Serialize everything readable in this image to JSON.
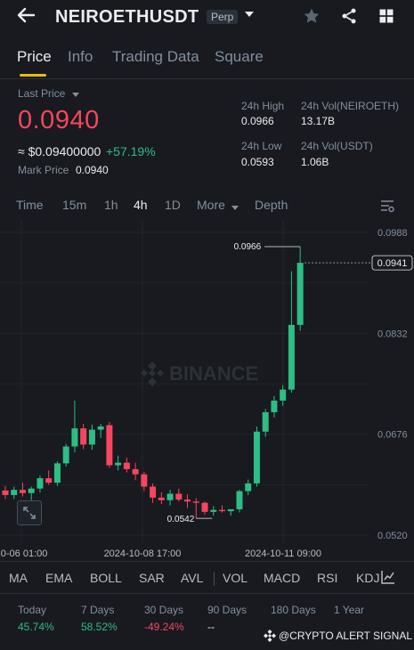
{
  "header": {
    "symbol": "NEIROETHUSDT",
    "contract_type": "Perp",
    "icons": [
      "back-arrow-icon",
      "chevron-down-icon",
      "star-icon",
      "share-icon",
      "grid-icon"
    ]
  },
  "tabs": [
    {
      "label": "Price",
      "active": true
    },
    {
      "label": "Info",
      "active": false
    },
    {
      "label": "Trading Data",
      "active": false
    },
    {
      "label": "Square",
      "active": false
    }
  ],
  "ticker": {
    "last_price_label": "Last Price",
    "last_price": "0.0940",
    "fiat_value": "≈ $0.09400000",
    "change_pct": "+57.19%",
    "mark_price_label": "Mark Price",
    "mark_price": "0.0940",
    "high_label": "24h High",
    "high": "0.0966",
    "low_label": "24h Low",
    "low": "0.0593",
    "vol_base_label": "24h Vol(NEIROETH)",
    "vol_base": "13.17B",
    "vol_quote_label": "24h Vol(USDT)",
    "vol_quote": "1.06B"
  },
  "timeframes": [
    {
      "label": "Time",
      "active": false
    },
    {
      "label": "15m",
      "active": false
    },
    {
      "label": "1h",
      "active": false
    },
    {
      "label": "4h",
      "active": true
    },
    {
      "label": "1D",
      "active": false
    },
    {
      "label": "More",
      "active": false
    },
    {
      "label": "Depth",
      "active": false
    }
  ],
  "chart_data": {
    "type": "candlestick",
    "watermark": "BINANCE",
    "y_ticks": [
      "0.0988",
      "0.0832",
      "0.0676",
      "0.0520"
    ],
    "ylim": [
      0.052,
      0.0988
    ],
    "x_ticks": [
      "10-06 01:00",
      "2024-10-08 17:00",
      "2024-10-11 09:00"
    ],
    "current_price_tag": "0.0941",
    "high_annotation": "0.0966",
    "low_annotation": "0.0542",
    "colors": {
      "up": "#2ebd85",
      "down": "#f6465d"
    },
    "candles": [
      {
        "o": 0.0589,
        "h": 0.0596,
        "l": 0.0576,
        "c": 0.0582
      },
      {
        "o": 0.0582,
        "h": 0.0595,
        "l": 0.0576,
        "c": 0.059
      },
      {
        "o": 0.059,
        "h": 0.0601,
        "l": 0.058,
        "c": 0.0585
      },
      {
        "o": 0.0585,
        "h": 0.0595,
        "l": 0.0574,
        "c": 0.0592
      },
      {
        "o": 0.0592,
        "h": 0.0612,
        "l": 0.0586,
        "c": 0.0608
      },
      {
        "o": 0.0608,
        "h": 0.062,
        "l": 0.0598,
        "c": 0.0601
      },
      {
        "o": 0.0601,
        "h": 0.0634,
        "l": 0.0596,
        "c": 0.0631
      },
      {
        "o": 0.0631,
        "h": 0.0661,
        "l": 0.0626,
        "c": 0.0657
      },
      {
        "o": 0.0657,
        "h": 0.0728,
        "l": 0.0648,
        "c": 0.0685
      },
      {
        "o": 0.0685,
        "h": 0.0692,
        "l": 0.0653,
        "c": 0.066
      },
      {
        "o": 0.066,
        "h": 0.0691,
        "l": 0.0652,
        "c": 0.0683
      },
      {
        "o": 0.0683,
        "h": 0.0692,
        "l": 0.067,
        "c": 0.0688
      },
      {
        "o": 0.069,
        "h": 0.0695,
        "l": 0.0624,
        "c": 0.0628
      },
      {
        "o": 0.0628,
        "h": 0.0643,
        "l": 0.062,
        "c": 0.0632
      },
      {
        "o": 0.0632,
        "h": 0.064,
        "l": 0.0617,
        "c": 0.0622
      },
      {
        "o": 0.0622,
        "h": 0.0632,
        "l": 0.0605,
        "c": 0.0614
      },
      {
        "o": 0.0614,
        "h": 0.0618,
        "l": 0.0588,
        "c": 0.0595
      },
      {
        "o": 0.0595,
        "h": 0.06,
        "l": 0.057,
        "c": 0.0578
      },
      {
        "o": 0.0578,
        "h": 0.0586,
        "l": 0.0568,
        "c": 0.0574
      },
      {
        "o": 0.0574,
        "h": 0.059,
        "l": 0.0566,
        "c": 0.0584
      },
      {
        "o": 0.0584,
        "h": 0.0592,
        "l": 0.0572,
        "c": 0.0575
      },
      {
        "o": 0.0575,
        "h": 0.0583,
        "l": 0.0562,
        "c": 0.0572
      },
      {
        "o": 0.0572,
        "h": 0.0577,
        "l": 0.0546,
        "c": 0.057
      },
      {
        "o": 0.057,
        "h": 0.0572,
        "l": 0.0552,
        "c": 0.0556
      },
      {
        "o": 0.0556,
        "h": 0.0565,
        "l": 0.055,
        "c": 0.0559
      },
      {
        "o": 0.0559,
        "h": 0.0566,
        "l": 0.0555,
        "c": 0.0557
      },
      {
        "o": 0.0557,
        "h": 0.056,
        "l": 0.055,
        "c": 0.056
      },
      {
        "o": 0.056,
        "h": 0.059,
        "l": 0.0555,
        "c": 0.0588
      },
      {
        "o": 0.0588,
        "h": 0.0606,
        "l": 0.0582,
        "c": 0.06
      },
      {
        "o": 0.06,
        "h": 0.0688,
        "l": 0.0595,
        "c": 0.068
      },
      {
        "o": 0.068,
        "h": 0.0715,
        "l": 0.0672,
        "c": 0.071
      },
      {
        "o": 0.071,
        "h": 0.0735,
        "l": 0.0702,
        "c": 0.0728
      },
      {
        "o": 0.0728,
        "h": 0.0752,
        "l": 0.072,
        "c": 0.0745
      },
      {
        "o": 0.0745,
        "h": 0.0928,
        "l": 0.074,
        "c": 0.0845
      },
      {
        "o": 0.0845,
        "h": 0.0966,
        "l": 0.0836,
        "c": 0.0941
      }
    ]
  },
  "indicators": [
    "MA",
    "EMA",
    "BOLL",
    "SAR",
    "AVL",
    "VOL",
    "MACD",
    "RSI",
    "KDJ"
  ],
  "performance": [
    {
      "label": "Today",
      "value": "45.74%",
      "color": "#2ebd85"
    },
    {
      "label": "7 Days",
      "value": "58.52%",
      "color": "#2ebd85"
    },
    {
      "label": "30 Days",
      "value": "-49.24%",
      "color": "#f6465d"
    },
    {
      "label": "90 Days",
      "value": "--",
      "color": "#eaecef"
    },
    {
      "label": "180 Days",
      "value": "--",
      "color": "#eaecef"
    },
    {
      "label": "1 Year",
      "value": "--",
      "color": "#eaecef"
    }
  ],
  "watermark_credit": "@CRYPTO ALERT SIGNAL"
}
